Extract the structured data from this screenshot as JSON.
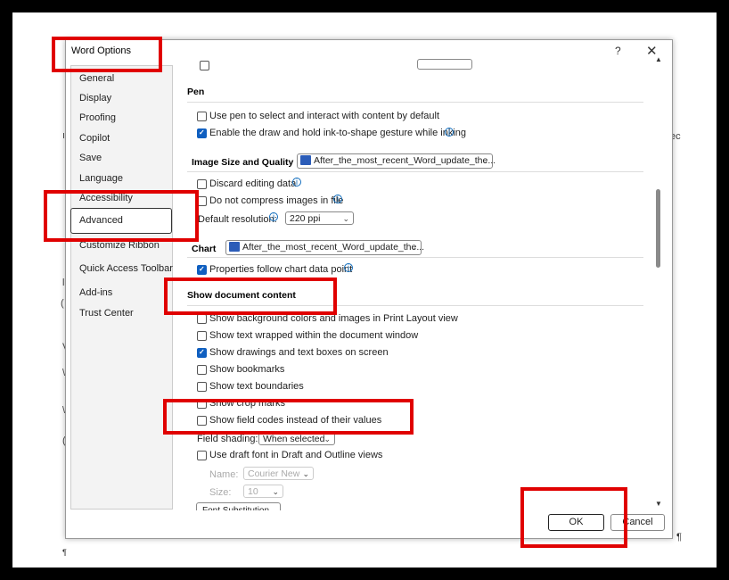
{
  "dialog": {
    "title": "Word Options",
    "help_label": "?",
    "close_label": "✕"
  },
  "sidebar": {
    "items": [
      {
        "label": "General"
      },
      {
        "label": "Display"
      },
      {
        "label": "Proofing"
      },
      {
        "label": "Copilot"
      },
      {
        "label": "Save"
      },
      {
        "label": "Language"
      },
      {
        "label": "Accessibility"
      },
      {
        "label": "Advanced",
        "selected": true
      },
      {
        "label": "Customize Ribbon"
      },
      {
        "label": "Quick Access Toolbar"
      },
      {
        "label": "Add-ins"
      },
      {
        "label": "Trust Center"
      }
    ]
  },
  "pen": {
    "heading": "Pen",
    "opt1": {
      "label": "Use pen to select and interact with content by default",
      "checked": false
    },
    "opt2": {
      "label": "Enable the draw and hold ink-to-shape gesture while inking",
      "checked": true
    }
  },
  "image": {
    "heading": "Image Size and Quality",
    "file": "After_the_most_recent_Word_update_the...",
    "discard": {
      "label": "Discard editing data",
      "checked": false
    },
    "compress": {
      "label": "Do not compress images in file",
      "checked": false
    },
    "resolution_label": "Default resolution:",
    "resolution_value": "220 ppi"
  },
  "chart": {
    "heading": "Chart",
    "file": "After_the_most_recent_Word_update_the...",
    "follow": {
      "label": "Properties follow chart data point",
      "checked": true
    }
  },
  "show": {
    "heading": "Show document content",
    "items": [
      {
        "label": "Show background colors and images in Print Layout view",
        "checked": false
      },
      {
        "label": "Show text wrapped within the document window",
        "checked": false
      },
      {
        "label": "Show drawings and text boxes on screen",
        "checked": true
      },
      {
        "label": "Show bookmarks",
        "checked": false
      },
      {
        "label": "Show text boundaries",
        "checked": false
      },
      {
        "label": "Show crop marks",
        "checked": false
      },
      {
        "label": "Show field codes instead of their values",
        "checked": false
      }
    ],
    "field_shading_label": "Field shading:",
    "field_shading_value": "When selected",
    "draft_font": {
      "label": "Use draft font in Draft and Outline views",
      "checked": false
    },
    "name_label": "Name:",
    "name_value": "Courier New",
    "size_label": "Size:",
    "size_value": "10",
    "font_sub": "Font Substitution..."
  },
  "buttons": {
    "ok": "OK",
    "cancel": "Cancel"
  },
  "doc": {
    "pilcrow": "¶"
  },
  "colors": {
    "highlight": "#e00000",
    "accent": "#0f5fc0"
  }
}
